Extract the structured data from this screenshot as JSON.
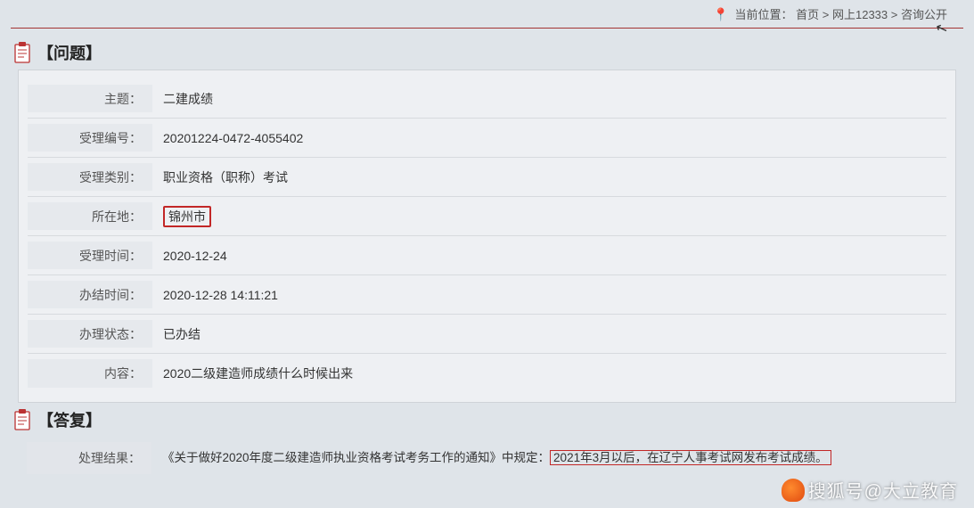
{
  "breadcrumb": {
    "prefix": "当前位置：",
    "home": "首页",
    "sep": ">",
    "mid": "网上12333",
    "last": "咨询公开"
  },
  "question": {
    "heading": "【问题】",
    "rows": {
      "subject_label": "主题：",
      "subject_value": "二建成绩",
      "acceptno_label": "受理编号：",
      "acceptno_value": "20201224-0472-4055402",
      "category_label": "受理类别：",
      "category_value": "职业资格（职称）考试",
      "location_label": "所在地：",
      "location_value": "锦州市",
      "accepttime_label": "受理时间：",
      "accepttime_value": "2020-12-24",
      "finishtime_label": "办结时间：",
      "finishtime_value": "2020-12-28 14:11:21",
      "status_label": "办理状态：",
      "status_value": "已办结",
      "content_label": "内容：",
      "content_value": "2020二级建造师成绩什么时候出来"
    }
  },
  "answer": {
    "heading": "【答复】",
    "result_label": "处理结果：",
    "result_prefix": "《关于做好2020年度二级建造师执业资格考试考务工作的通知》中规定：",
    "result_highlight": "2021年3月以后，在辽宁人事考试网发布考试成绩。"
  },
  "watermark": "搜狐号@大立教育"
}
